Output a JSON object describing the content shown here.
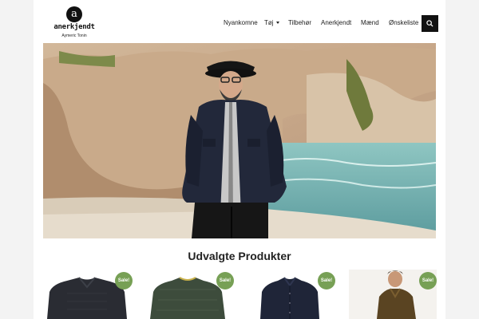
{
  "brand": {
    "badge": "a",
    "name": "anerkjendt",
    "sub": "Aymeric Tonin"
  },
  "nav": {
    "items": [
      "Nyankomne",
      "Tøj",
      "Tilbehør",
      "Anerkjendt",
      "Mænd",
      "Ønskeliste"
    ]
  },
  "search": {
    "icon": "search-icon"
  },
  "section": {
    "title": "Udvalgte Produkter"
  },
  "products": [
    {
      "badge": "Sale!",
      "image": "dark-shirt"
    },
    {
      "badge": "Sale!",
      "image": "green-sweater"
    },
    {
      "badge": "Sale!",
      "image": "navy-shirt"
    },
    {
      "badge": "Sale!",
      "image": "model-corduroy-shirt"
    }
  ],
  "colors": {
    "sale_badge": "#77a055",
    "text": "#222222",
    "button": "#111111"
  }
}
